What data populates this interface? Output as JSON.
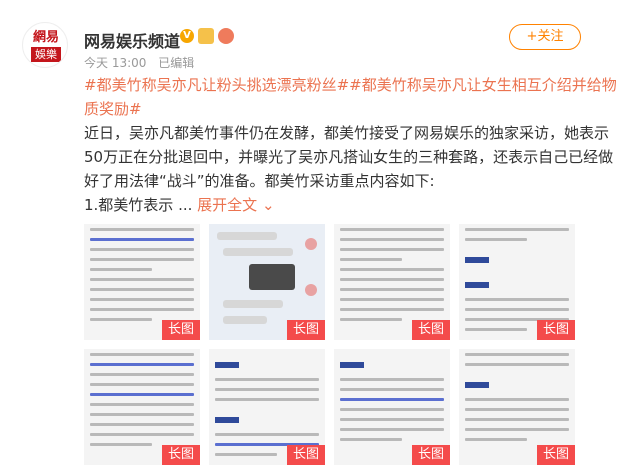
{
  "account": {
    "logo_top": "網易",
    "logo_bottom": "娛樂",
    "name": "网易娱乐频道",
    "verified": "V"
  },
  "follow_button": {
    "label": "+关注",
    "accent": "#ff8200"
  },
  "meta": {
    "time": "今天 13:00",
    "edited": "已编辑"
  },
  "post": {
    "topics": "#都美竹称吴亦凡让粉头挑选漂亮粉丝##都美竹称吴亦凡让女生相互介绍并给物质奖励#",
    "body": "近日，吴亦凡都美竹事件仍在发酵，都美竹接受了网易娱乐的独家采访，她表示50万正在分批退回中，并曝光了吴亦凡搭讪女生的三种套路，还表示自己已经做好了用法律“战斗”的准备。都美竹采访重点内容如下:",
    "preview": "1.都美竹表示 ...",
    "expand_label": "展开全文",
    "topic_color": "#eb7350"
  },
  "images": [
    {
      "kind": "doc",
      "tag": "长图"
    },
    {
      "kind": "chat",
      "tag": "长图"
    },
    {
      "kind": "doc",
      "tag": "长图"
    },
    {
      "kind": "doc",
      "tag": "长图"
    },
    {
      "kind": "doc",
      "tag": "长图"
    },
    {
      "kind": "doc",
      "tag": "长图"
    },
    {
      "kind": "doc",
      "tag": "长图"
    },
    {
      "kind": "doc",
      "tag": "长图"
    }
  ]
}
